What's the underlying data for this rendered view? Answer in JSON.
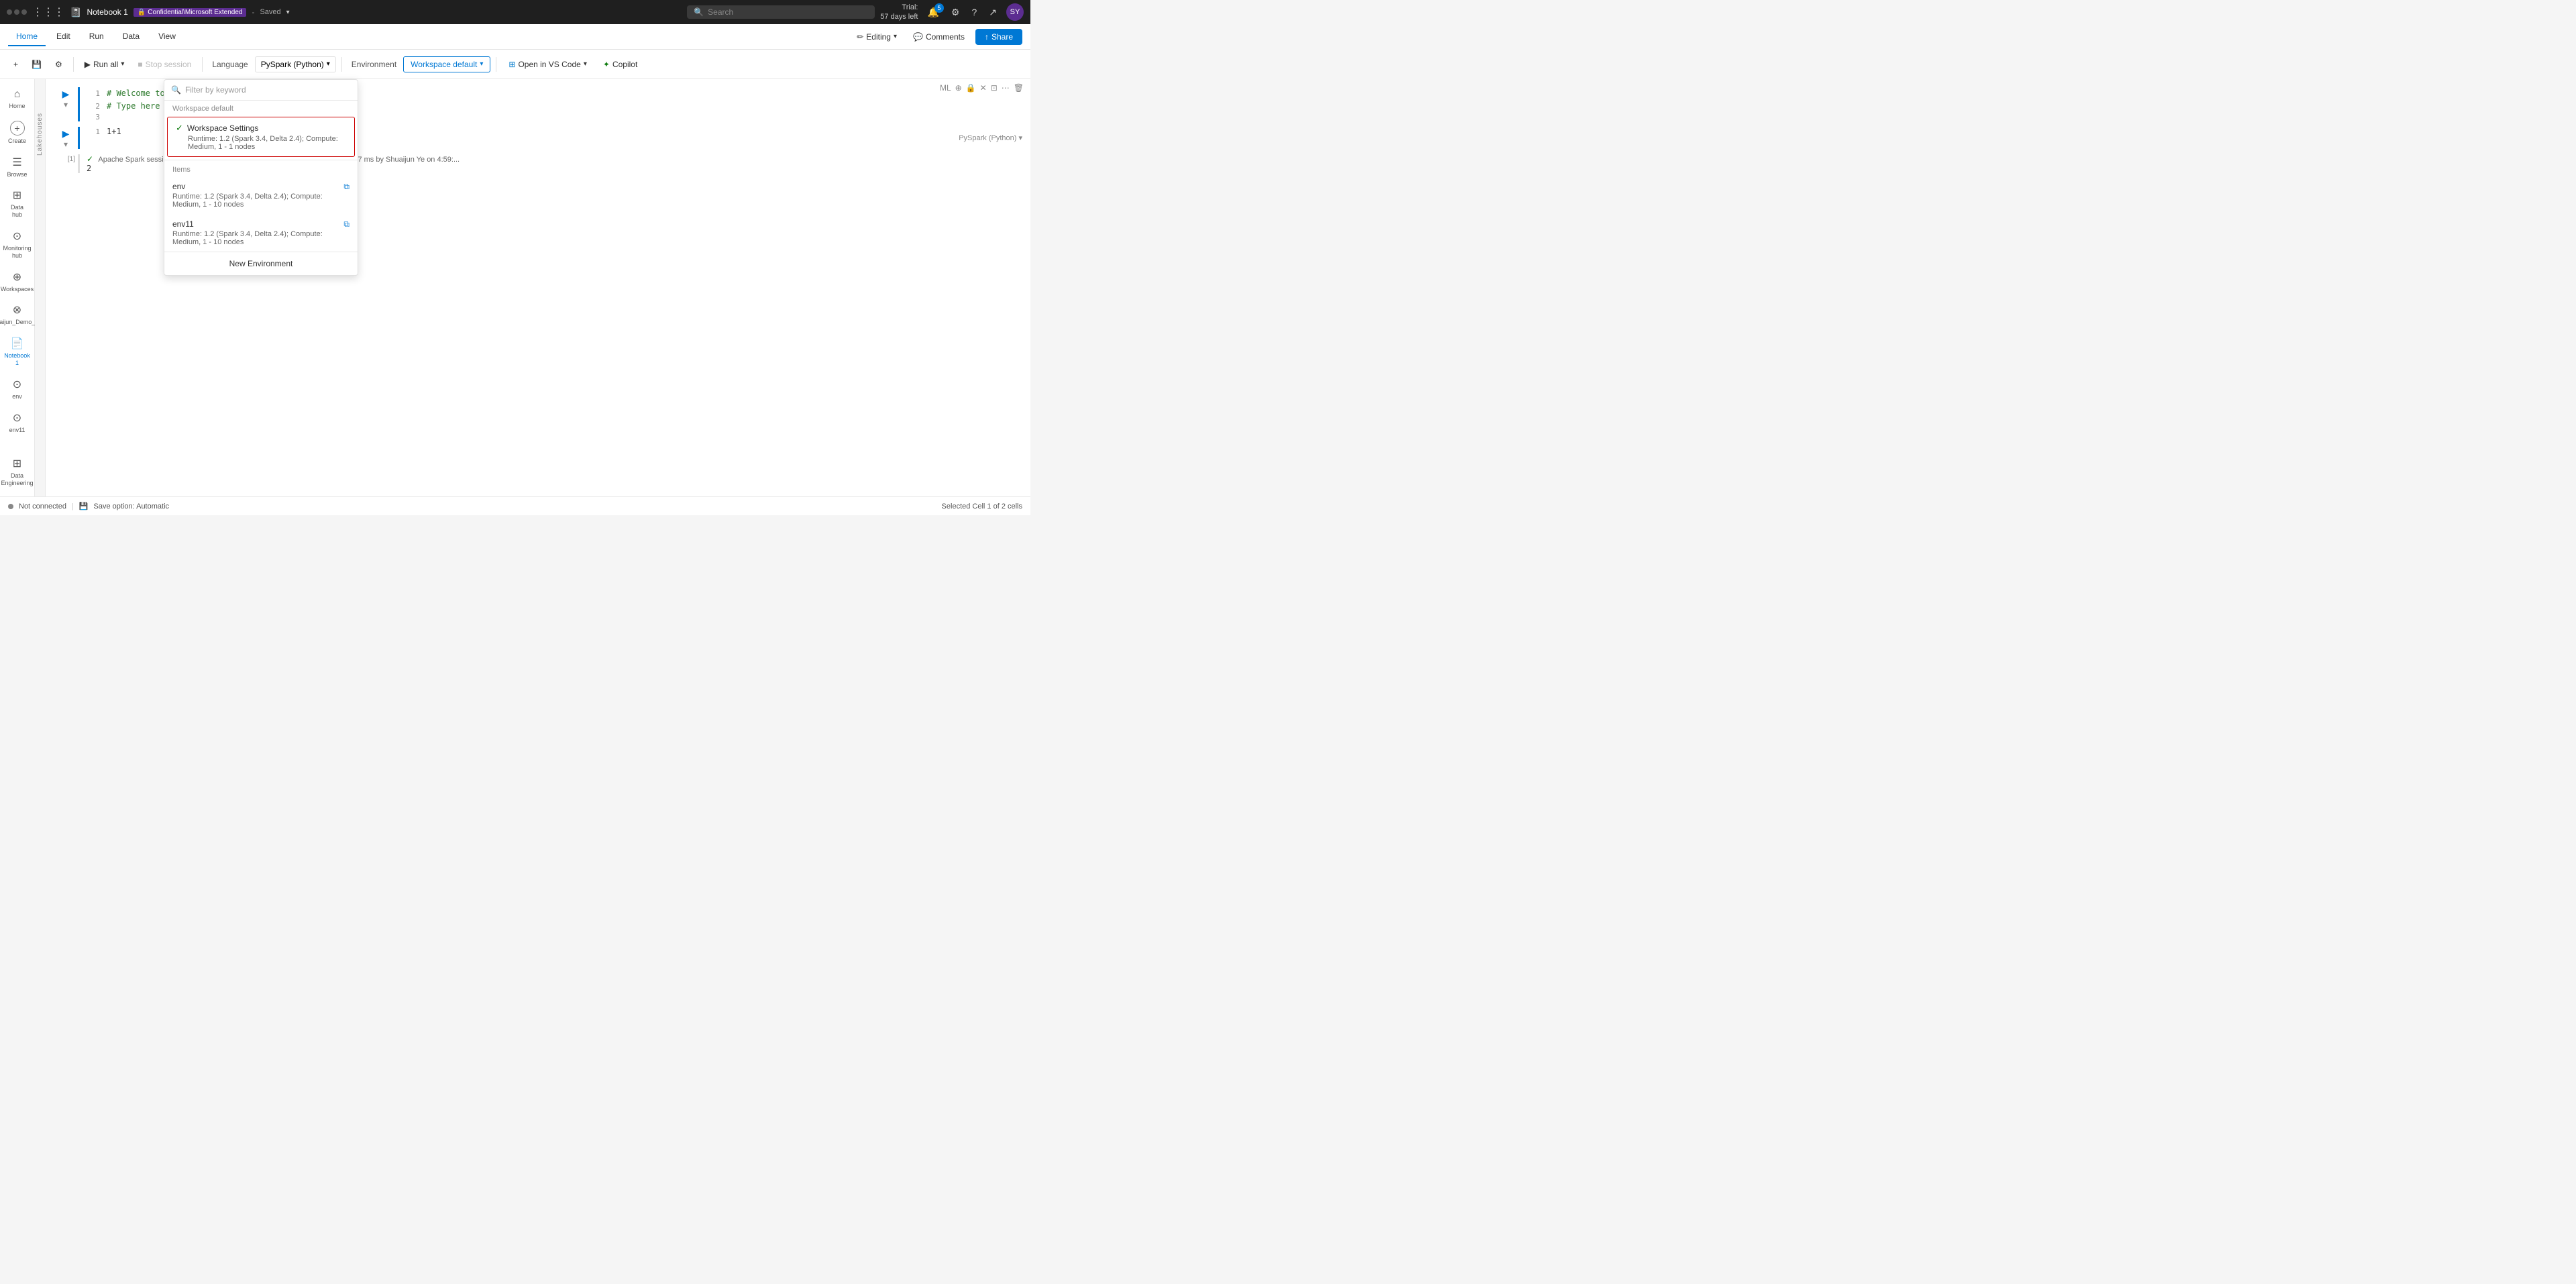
{
  "titlebar": {
    "notebook_title": "Notebook 1",
    "tenant": "Confidential\\Microsoft Extended",
    "separator": "-",
    "save_status": "Saved",
    "search_placeholder": "Search",
    "trial_text": "Trial:",
    "days_left": "57 days left",
    "notif_count": "5",
    "avatar_initials": "SY"
  },
  "menubar": {
    "tabs": [
      "Home",
      "Edit",
      "Run",
      "Data",
      "View"
    ],
    "active_tab": "Home",
    "editing_label": "Editing",
    "comments_label": "Comments",
    "share_label": "Share"
  },
  "toolbar": {
    "run_all_label": "Run all",
    "stop_session_label": "Stop session",
    "language_label": "Language",
    "pyspark_label": "PySpark (Python)",
    "environment_label": "Environment",
    "workspace_default_label": "Workspace default",
    "open_vs_code_label": "Open in VS Code",
    "copilot_label": "Copilot"
  },
  "sidebar": {
    "items": [
      {
        "id": "home",
        "label": "Home",
        "icon": "⌂"
      },
      {
        "id": "create",
        "label": "Create",
        "icon": "+"
      },
      {
        "id": "browse",
        "label": "Browse",
        "icon": "☰"
      },
      {
        "id": "data-hub",
        "label": "Data hub",
        "icon": "⊞"
      },
      {
        "id": "monitoring",
        "label": "Monitoring hub",
        "icon": "⊙"
      },
      {
        "id": "workspaces",
        "label": "Workspaces",
        "icon": "⊕"
      },
      {
        "id": "shuaijun",
        "label": "Shuaijun_Demo_Env",
        "icon": "⊗"
      },
      {
        "id": "notebook1",
        "label": "Notebook 1",
        "icon": "📄",
        "active": true
      },
      {
        "id": "env",
        "label": "env",
        "icon": "⊙"
      },
      {
        "id": "env11",
        "label": "env11",
        "icon": "⊙"
      },
      {
        "id": "data-eng",
        "label": "Data Engineering",
        "icon": "⊞"
      }
    ]
  },
  "collapse_panel": {
    "label": "Lakehouses"
  },
  "cells": [
    {
      "id": "cell1",
      "number": 1,
      "lines": [
        {
          "num": 1,
          "text": "# Welcome to your new notebook"
        },
        {
          "num": 2,
          "text": "# Type here in the cell editor to add code!"
        },
        {
          "num": 3,
          "text": ""
        }
      ]
    },
    {
      "id": "cell2",
      "number": 2,
      "lines": [
        {
          "num": 1,
          "text": "1+1"
        }
      ],
      "output": {
        "bracket": "[1]",
        "check": true,
        "status_text": "Apache Spark session ready in 15 sec 737 ms. Command executed in 2 sec 917 ms by Shuaijun Ye on 4:59:...",
        "result": "2"
      }
    }
  ],
  "right_toolbar": {
    "labels": [
      "ML",
      "⊕",
      "🔒",
      "✕",
      "⊡",
      "⋯",
      "🗑"
    ]
  },
  "cell2_right": {
    "label": "PySpark (Python)"
  },
  "status_bar": {
    "not_connected": "Not connected",
    "save_option": "Save option: Automatic",
    "selected_cell": "Selected Cell 1 of 2 cells"
  },
  "dropdown": {
    "search_placeholder": "Filter by keyword",
    "section_workspace": "Workspace default",
    "workspace_settings": {
      "name": "Workspace Settings",
      "check": true,
      "sub": "Runtime: 1.2 (Spark 3.4, Delta 2.4); Compute: Medium, 1 - 1 nodes"
    },
    "items_section": "Items",
    "envs": [
      {
        "name": "env",
        "sub": "Runtime: 1.2 (Spark 3.4, Delta 2.4); Compute: Medium, 1 - 10 nodes"
      },
      {
        "name": "env11",
        "sub": "Runtime: 1.2 (Spark 3.4, Delta 2.4); Compute: Medium, 1 - 10 nodes"
      }
    ],
    "new_env_label": "New Environment"
  }
}
